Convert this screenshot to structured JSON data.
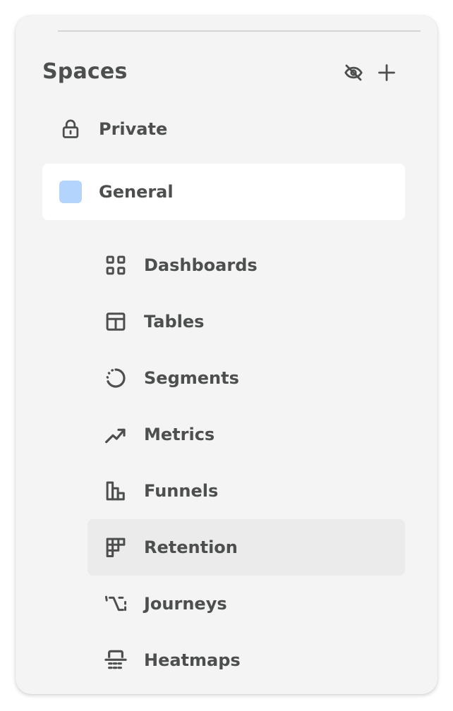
{
  "spaces_header": {
    "title": "Spaces",
    "hide_icon": "eye-off-icon",
    "add_icon": "plus-icon"
  },
  "spaces": [
    {
      "label": "Private",
      "icon": "lock-icon"
    },
    {
      "label": "General",
      "icon": "color-swatch",
      "color": "#b3d4fc",
      "selected": true
    }
  ],
  "nav": [
    {
      "label": "Dashboards",
      "icon": "grid-icon"
    },
    {
      "label": "Tables",
      "icon": "table-icon"
    },
    {
      "label": "Segments",
      "icon": "segment-circle-icon"
    },
    {
      "label": "Metrics",
      "icon": "trend-up-icon"
    },
    {
      "label": "Funnels",
      "icon": "funnel-bars-icon"
    },
    {
      "label": "Retention",
      "icon": "retention-icon",
      "active": true
    },
    {
      "label": "Journeys",
      "icon": "journey-icon"
    },
    {
      "label": "Heatmaps",
      "icon": "heatmap-icon"
    }
  ],
  "colors": {
    "panel_bg": "#f3f4f3",
    "text": "#4c4f4d",
    "selected_row_bg": "#ffffff",
    "active_item_bg": "#eaebea",
    "swatch": "#b3d4fc"
  }
}
